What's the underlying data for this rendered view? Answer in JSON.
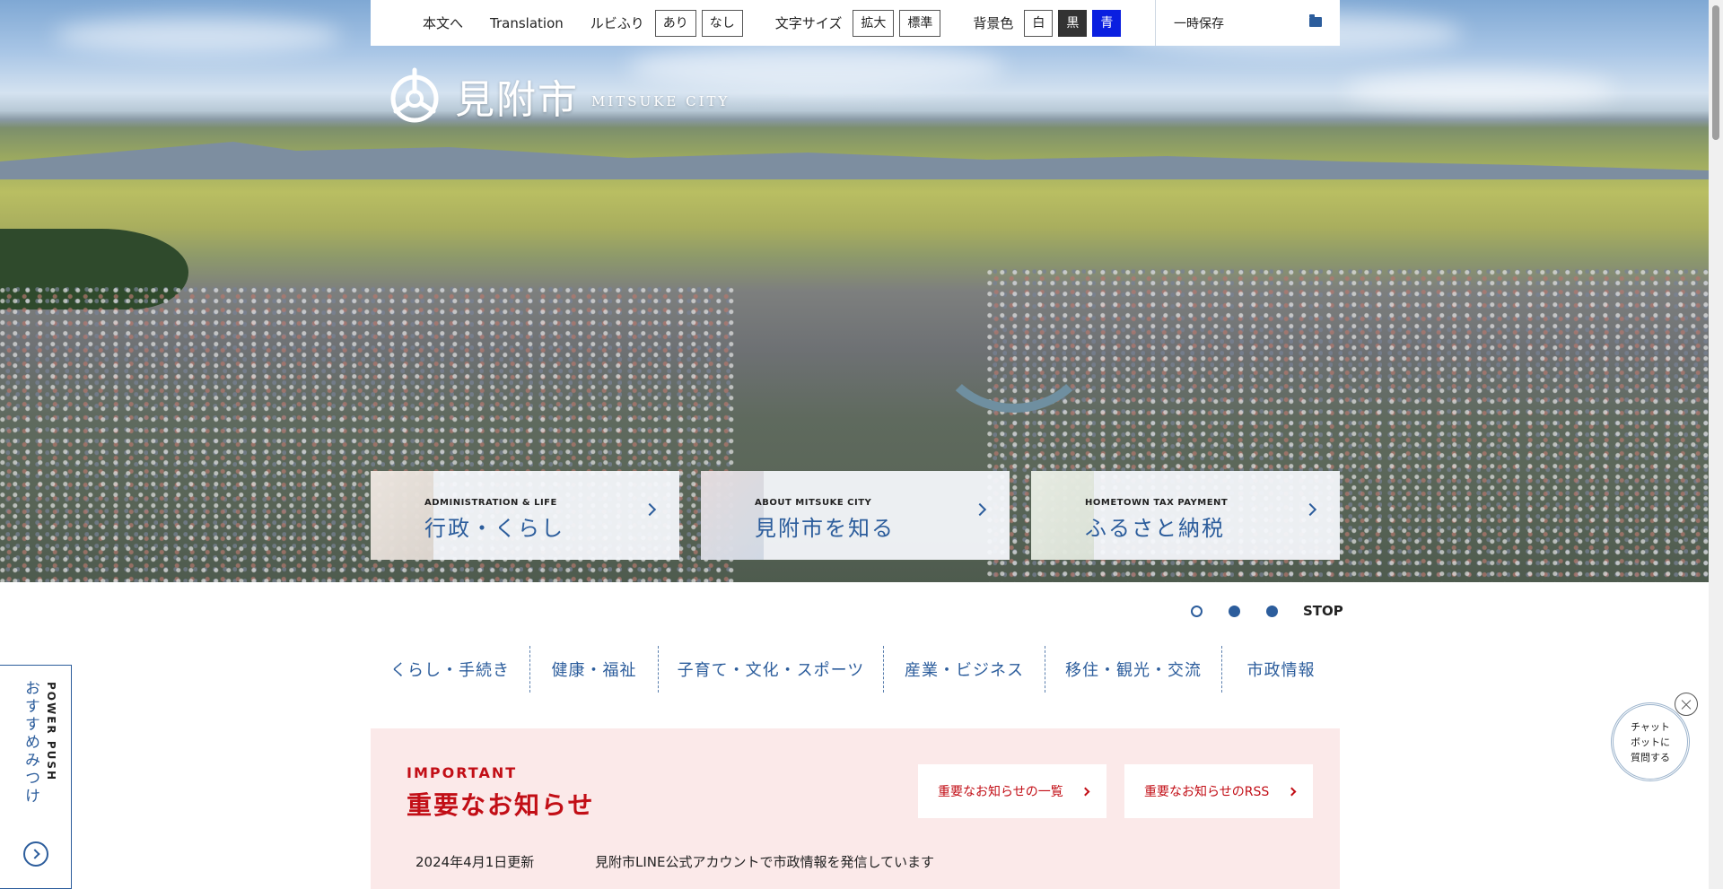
{
  "utility": {
    "skip": "本文へ",
    "translation": "Translation",
    "ruby_label": "ルビふり",
    "ruby_on": "あり",
    "ruby_off": "なし",
    "fontsize_label": "文字サイズ",
    "font_large": "拡大",
    "font_standard": "標準",
    "bg_label": "背景色",
    "bg_white": "白",
    "bg_black": "黒",
    "bg_blue": "青",
    "save": "一時保存"
  },
  "logo": {
    "jp": "見附市",
    "en": "MITSUKE CITY"
  },
  "cards": [
    {
      "sub": "ADMINISTRATION & LIFE",
      "title": "行政・くらし"
    },
    {
      "sub": "ABOUT MITSUKE CITY",
      "title": "見附市を知る"
    },
    {
      "sub": "HOMETOWN TAX PAYMENT",
      "title": "ふるさと納税"
    }
  ],
  "slider": {
    "stop": "STOP"
  },
  "nav": [
    "くらし・手続き",
    "健康・福祉",
    "子育て・文化・スポーツ",
    "産業・ビジネス",
    "移住・観光・交流",
    "市政情報"
  ],
  "important": {
    "en": "IMPORTANT",
    "jp": "重要なお知らせ",
    "list_button": "重要なお知らせの一覧",
    "rss_button": "重要なお知らせのRSS",
    "date": "2024年4月1日更新",
    "text": "見附市LINE公式アカウントで市政情報を発信しています"
  },
  "sidetab": {
    "en": "POWER PUSH",
    "jp": "おすすめみつけ"
  },
  "chatbot": {
    "line1": "チャット",
    "line2": "ボットに",
    "line3": "質問する"
  },
  "colors": {
    "brand_blue": "#2c5d9c",
    "important_red": "#c20e16",
    "important_bg": "#fbe9e9",
    "bg_blue_option": "#0a1fe0"
  }
}
